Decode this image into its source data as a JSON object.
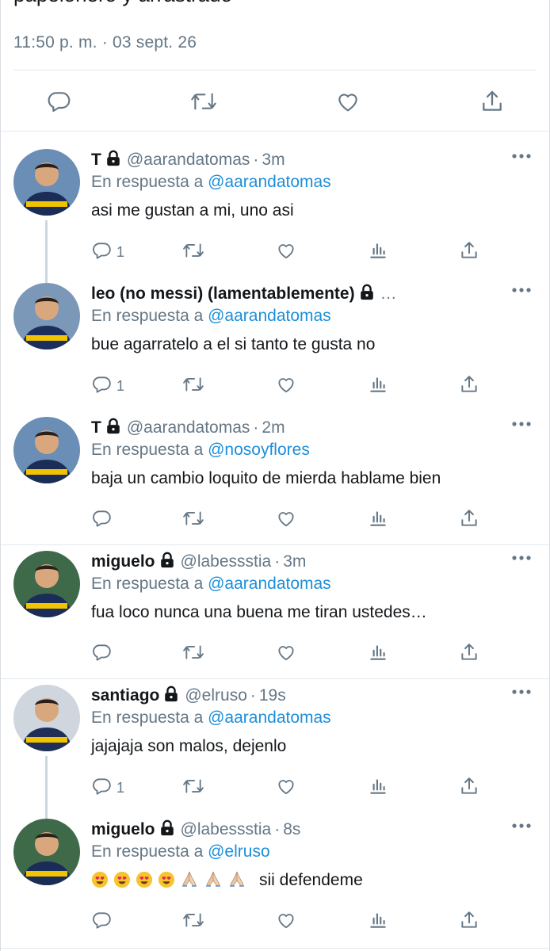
{
  "tweet": {
    "text_partial": "papelonero y arrastrado",
    "timestamp": "11:50 p. m. · 03 sept. 26",
    "actions": [
      "reply-icon",
      "retweet-icon",
      "like-icon",
      "share-icon"
    ]
  },
  "replies": [
    {
      "name": "T",
      "locked": true,
      "handle": "@aarandatomas",
      "time": "3m",
      "reply_prefix": "En respuesta a",
      "reply_to": "@aarandatomas",
      "text": "asi me gustan a mi, uno asi",
      "reply_count": "1"
    },
    {
      "name": "leo (no messi) (lamentablemente)",
      "locked": true,
      "handle": "…",
      "time": "",
      "reply_prefix": "En respuesta a",
      "reply_to": "@aarandatomas",
      "text": "bue agarratelo a el si tanto te gusta no",
      "reply_count": "1"
    },
    {
      "name": "T",
      "locked": true,
      "handle": "@aarandatomas",
      "time": "2m",
      "reply_prefix": "En respuesta a",
      "reply_to": "@nosoyflores",
      "text": "baja un cambio loquito de mierda hablame bien",
      "reply_count": ""
    },
    {
      "name": "miguelo",
      "locked": true,
      "handle": "@labessstia",
      "time": "3m",
      "reply_prefix": "En respuesta a",
      "reply_to": "@aarandatomas",
      "text": "fua loco nunca una buena me tiran ustedes…",
      "reply_count": ""
    },
    {
      "name": "santiago",
      "locked": true,
      "handle": "@elruso",
      "time": "19s",
      "reply_prefix": "En respuesta a",
      "reply_to": "@aarandatomas",
      "text": "jajajaja son malos, dejenlo",
      "reply_count": "1"
    },
    {
      "name": "miguelo",
      "locked": true,
      "handle": "@labessstia",
      "time": "8s",
      "reply_prefix": "En respuesta a",
      "reply_to": "@elruso",
      "text": "sii defendeme",
      "reply_count": "",
      "emojis": [
        "heart-eyes-emoji",
        "heart-eyes-emoji",
        "heart-eyes-emoji",
        "heart-eyes-emoji",
        "folded-hands-emoji",
        "folded-hands-emoji",
        "folded-hands-emoji"
      ]
    }
  ],
  "colors": {
    "link": "#1d8fd9",
    "muted": "#657786",
    "icon": "#657786",
    "separator": "#e1e8ed"
  }
}
